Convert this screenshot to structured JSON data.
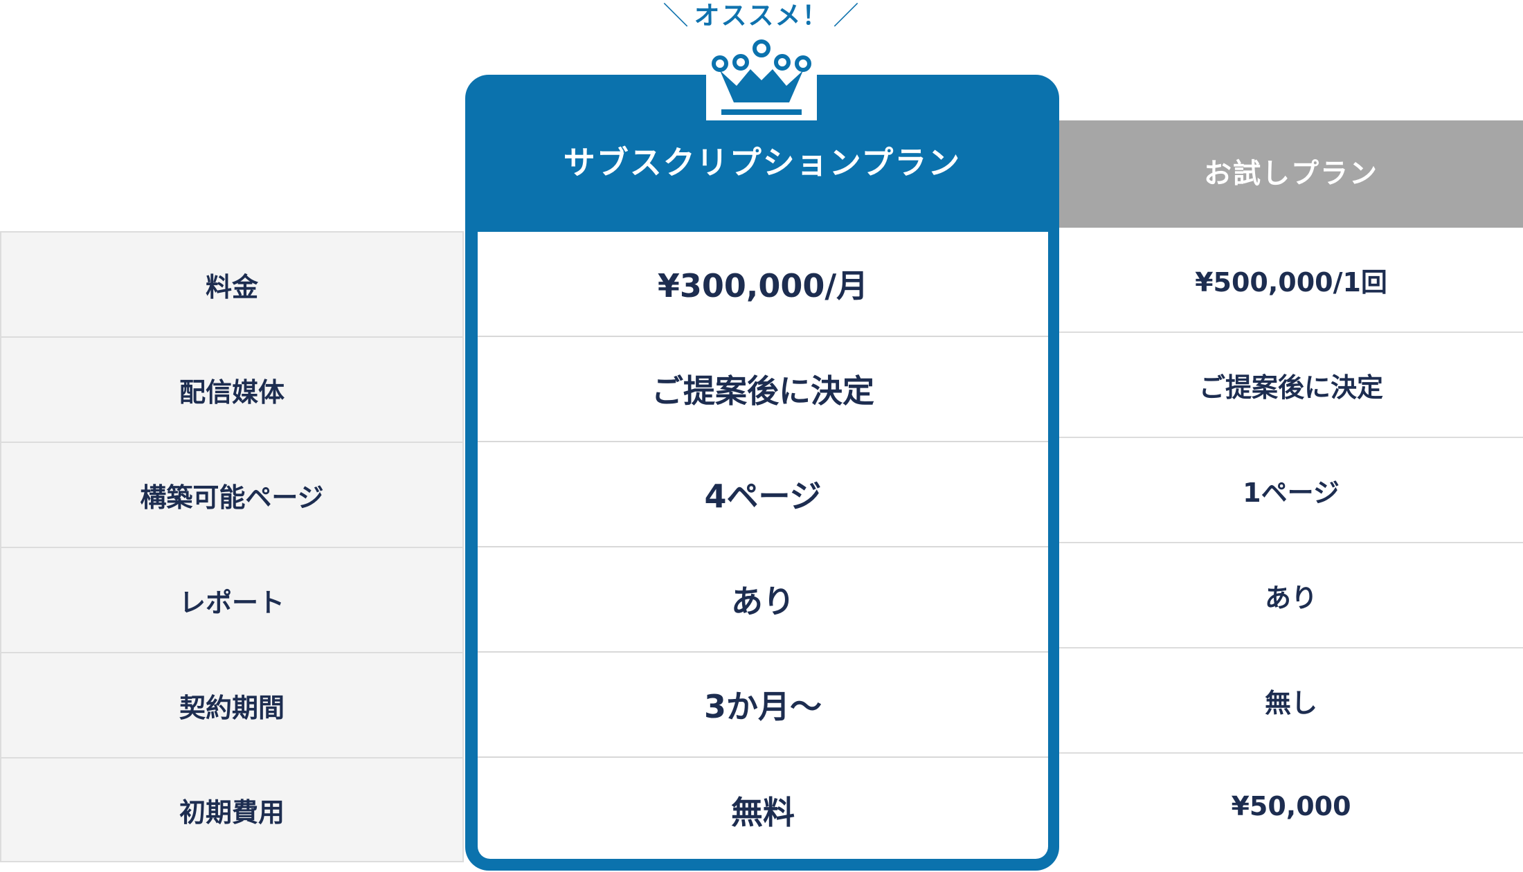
{
  "recommend": {
    "slash_left": "＼",
    "text": "オススメ！",
    "slash_right": "／"
  },
  "crown_icon": "crown-icon",
  "colors": {
    "accent": "#0b72ad",
    "trial_header": "#a6a6a6",
    "label_bg": "#f4f4f4",
    "text": "#1d2d50"
  },
  "plans": {
    "featured": {
      "title": "サブスクリプションプラン",
      "values": [
        "¥300,000/月",
        "ご提案後に決定",
        "4ページ",
        "あり",
        "3か月〜",
        "無料"
      ]
    },
    "trial": {
      "title": "お試しプラン",
      "values": [
        "¥500,000/1回",
        "ご提案後に決定",
        "1ページ",
        "あり",
        "無し",
        "¥50,000"
      ]
    }
  },
  "rows": [
    "料金",
    "配信媒体",
    "構築可能ページ",
    "レポート",
    "契約期間",
    "初期費用"
  ]
}
